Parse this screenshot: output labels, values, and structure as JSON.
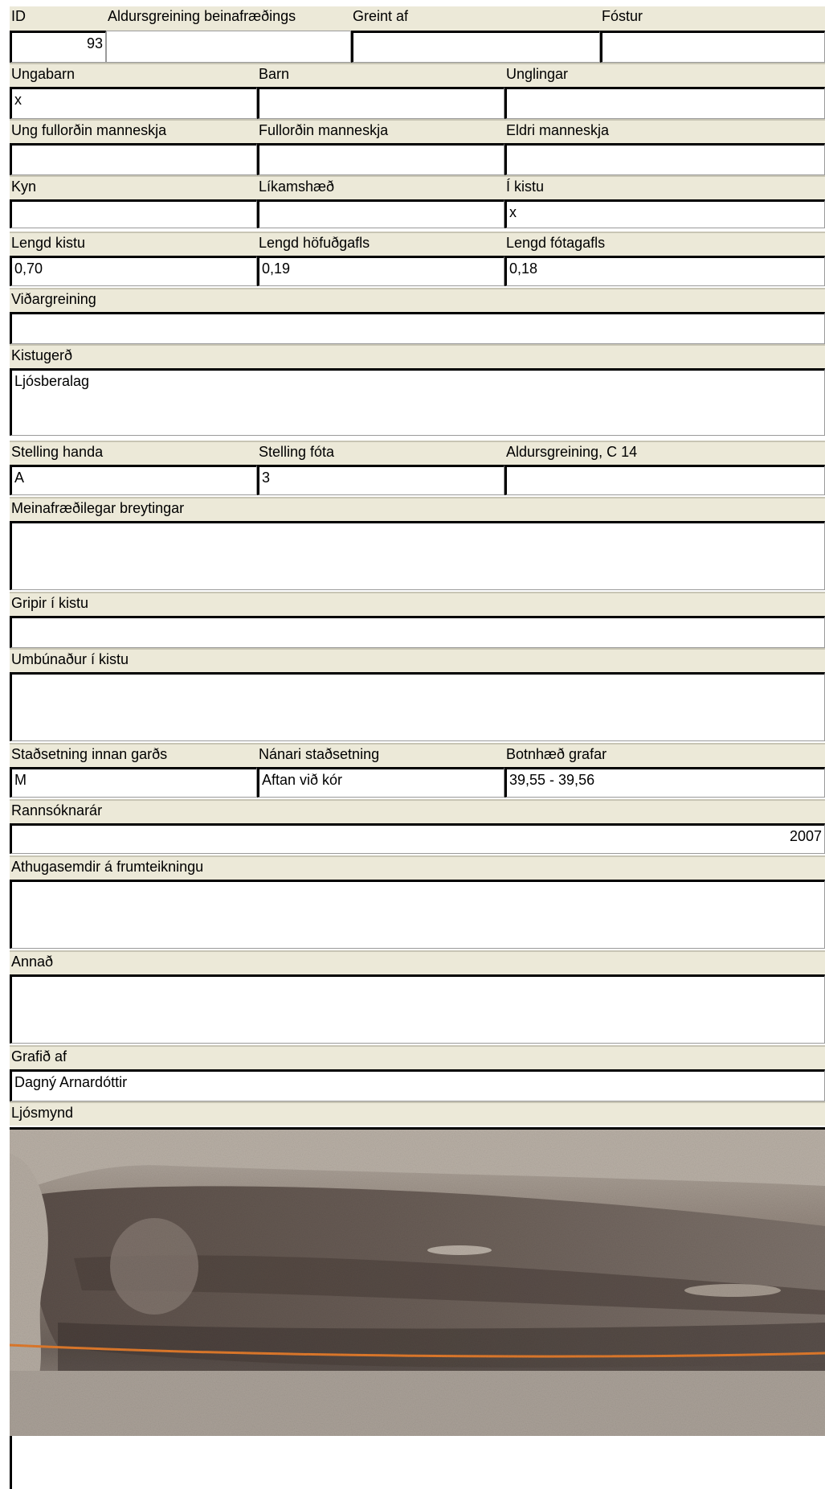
{
  "labels": {
    "id": "ID",
    "aldursgreining_beinafraedings": "Aldursgreining beinafræðings",
    "greint_af": "Greint af",
    "fostur": "Fóstur",
    "ungabarn": "Ungabarn",
    "barn": "Barn",
    "unglingar": "Unglingar",
    "ung_fullordin": "Ung fullorðin manneskja",
    "fullordin": "Fullorðin manneskja",
    "eldri": "Eldri manneskja",
    "kyn": "Kyn",
    "likamshaed": "Líkamshæð",
    "i_kistu": "Í kistu",
    "lengd_kistu": "Lengd kistu",
    "lengd_hofudgafls": "Lengd höfuðgafls",
    "lengd_fotagafls": "Lengd fótagafls",
    "vidargreining": "Viðargreining",
    "kistugerd": "Kistugerð",
    "stelling_handa": "Stelling handa",
    "stelling_fota": "Stelling fóta",
    "c14": "Aldursgreining, C 14",
    "meinafraedilegar": "Meinafræðilegar breytingar",
    "gripir": "Gripir í kistu",
    "umbunadur": "Umbúnaður í kistu",
    "stadsetning_innan": "Staðsetning innan garðs",
    "nanari": "Nánari staðsetning",
    "botnhaed": "Botnhæð grafar",
    "rannsoknarar": "Rannsóknarár",
    "athugasemdir": "Athugasemdir á frumteikningu",
    "annad": "Annað",
    "grafid_af": "Grafið af",
    "ljosmynd": "Ljósmynd"
  },
  "values": {
    "id": "93",
    "aldursgreining_beinafraedings": "",
    "greint_af": "",
    "fostur": "",
    "ungabarn": "x",
    "barn": "",
    "unglingar": "",
    "ung_fullordin": "",
    "fullordin": "",
    "eldri": "",
    "kyn": "",
    "likamshaed": "",
    "i_kistu": "x",
    "lengd_kistu": "0,70",
    "lengd_hofudgafls": "0,19",
    "lengd_fotagafls": "0,18",
    "vidargreining": "",
    "kistugerd": "Ljósberalag",
    "stelling_handa": "A",
    "stelling_fota": "3",
    "c14": "",
    "meinafraedilegar": "",
    "gripir": "",
    "umbunadur": "",
    "stadsetning_innan": "M",
    "nanari": "Aftan við kór",
    "botnhaed": "39,55 - 39,56",
    "rannsoknarar": "2007",
    "athugasemdir": "",
    "annad": "",
    "grafid_af": "Dagný Arnardóttir"
  },
  "colors": {
    "label_bg": "#ece9d8",
    "field_bg": "#ffffff",
    "field_border": "#000000"
  },
  "photo": {
    "icon": "excavation-photo"
  }
}
